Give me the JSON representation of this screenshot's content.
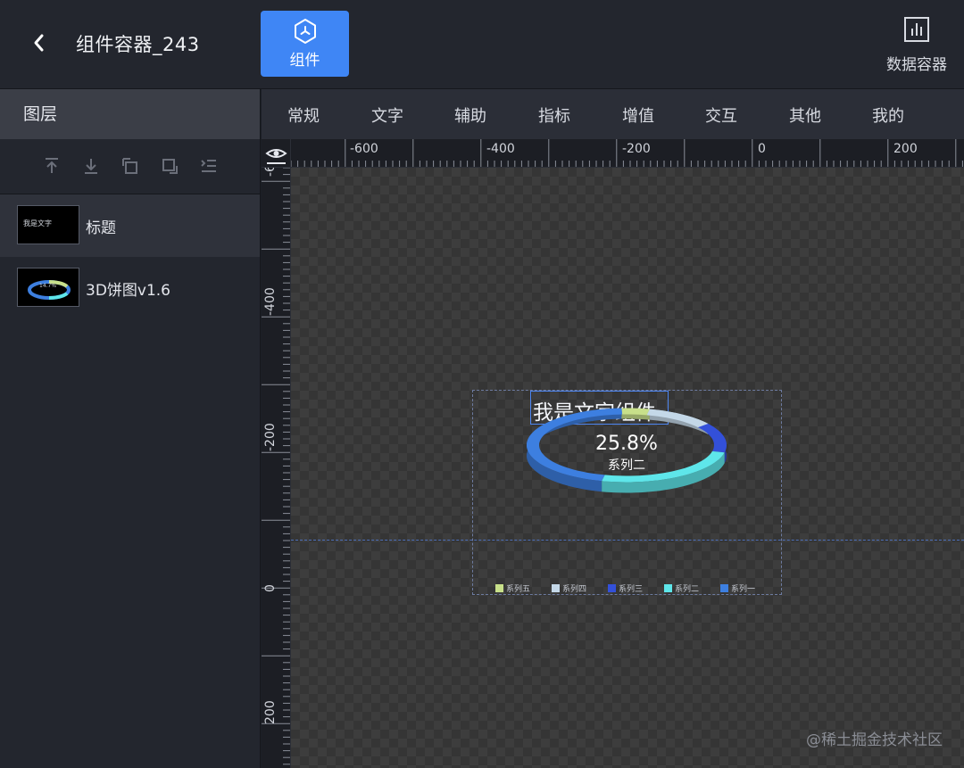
{
  "header": {
    "title": "组件容器_243",
    "component_button_label": "组件",
    "data_container_label": "数据容器"
  },
  "left_panel": {
    "title": "图层",
    "layers": [
      {
        "name": "标题",
        "thumb_text": "我是文字"
      },
      {
        "name": "3D饼图v1.6",
        "thumb_text": "14.7%"
      }
    ]
  },
  "menu": {
    "items": [
      "常规",
      "文字",
      "辅助",
      "指标",
      "增值",
      "交互",
      "其他",
      "我的"
    ]
  },
  "ruler": {
    "horizontal_labels": [
      "-600",
      "-400",
      "-200",
      "0",
      "200"
    ],
    "vertical_labels": [
      "-6",
      "-400",
      "-200",
      "0",
      "200"
    ]
  },
  "canvas": {
    "text_widget": "我是文字组件"
  },
  "chart_data": {
    "type": "pie",
    "variant": "3d-donut",
    "center_value": "25.8%",
    "center_label": "系列二",
    "series": [
      {
        "name": "系列一",
        "value": 45.2,
        "color": "#3d7fe0"
      },
      {
        "name": "系列二",
        "value": 25.8,
        "color": "#5ee6ea"
      },
      {
        "name": "系列三",
        "value": 13.0,
        "color": "#3350d9"
      },
      {
        "name": "系列四",
        "value": 11.5,
        "color": "#c4d8e8"
      },
      {
        "name": "系列五",
        "value": 4.5,
        "color": "#c8e08a"
      }
    ],
    "legend": [
      "系列五",
      "系列四",
      "系列三",
      "系列二",
      "系列一"
    ],
    "legend_position": "bottom"
  },
  "watermark": "@稀土掘金技术社区",
  "colors": {
    "accent": "#3f86f5",
    "panel": "#23262e",
    "canvas": "#3d3d3d"
  }
}
